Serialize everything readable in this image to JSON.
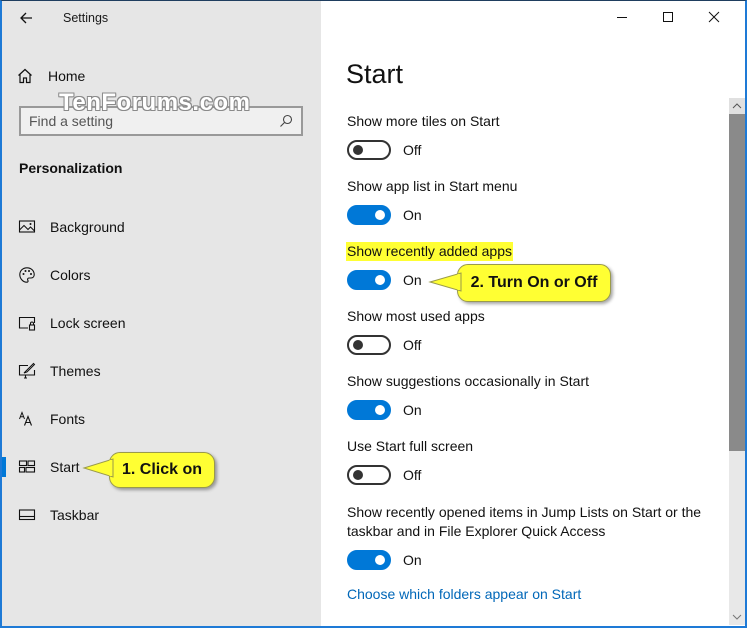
{
  "window": {
    "title": "Settings",
    "controls": {
      "minimize": "minimize-icon",
      "maximize": "maximize-icon",
      "close": "close-icon"
    }
  },
  "sidebar": {
    "back_icon": "back-arrow-icon",
    "home_label": "Home",
    "search_placeholder": "Find a setting",
    "section_title": "Personalization",
    "items": [
      {
        "label": "Background",
        "icon": "picture-icon",
        "active": false
      },
      {
        "label": "Colors",
        "icon": "palette-icon",
        "active": false
      },
      {
        "label": "Lock screen",
        "icon": "lock-screen-icon",
        "active": false
      },
      {
        "label": "Themes",
        "icon": "themes-icon",
        "active": false
      },
      {
        "label": "Fonts",
        "icon": "fonts-icon",
        "active": false
      },
      {
        "label": "Start",
        "icon": "start-tiles-icon",
        "active": true
      },
      {
        "label": "Taskbar",
        "icon": "taskbar-icon",
        "active": false
      }
    ]
  },
  "watermark": "TenForums.com",
  "main": {
    "title": "Start",
    "settings": [
      {
        "label": "Show more tiles on Start",
        "state": "Off",
        "on": false,
        "highlighted": false
      },
      {
        "label": "Show app list in Start menu",
        "state": "On",
        "on": true,
        "highlighted": false
      },
      {
        "label": "Show recently added apps",
        "state": "On",
        "on": true,
        "highlighted": true
      },
      {
        "label": "Show most used apps",
        "state": "Off",
        "on": false,
        "highlighted": false
      },
      {
        "label": "Show suggestions occasionally in Start",
        "state": "On",
        "on": true,
        "highlighted": false
      },
      {
        "label": "Use Start full screen",
        "state": "Off",
        "on": false,
        "highlighted": false
      },
      {
        "label_line1": "Show recently opened items in Jump Lists on Start or the",
        "label_line2": "taskbar and in File Explorer Quick Access",
        "state": "On",
        "on": true,
        "highlighted": false
      }
    ],
    "link": "Choose which folders appear on Start"
  },
  "annotations": {
    "callout1": "1. Click on",
    "callout2": "2. Turn On or Off",
    "fill_color": "#ffff33"
  },
  "colors": {
    "accent": "#0078d7",
    "link": "#0067b8",
    "sidebar_bg": "#e6e6e6"
  }
}
